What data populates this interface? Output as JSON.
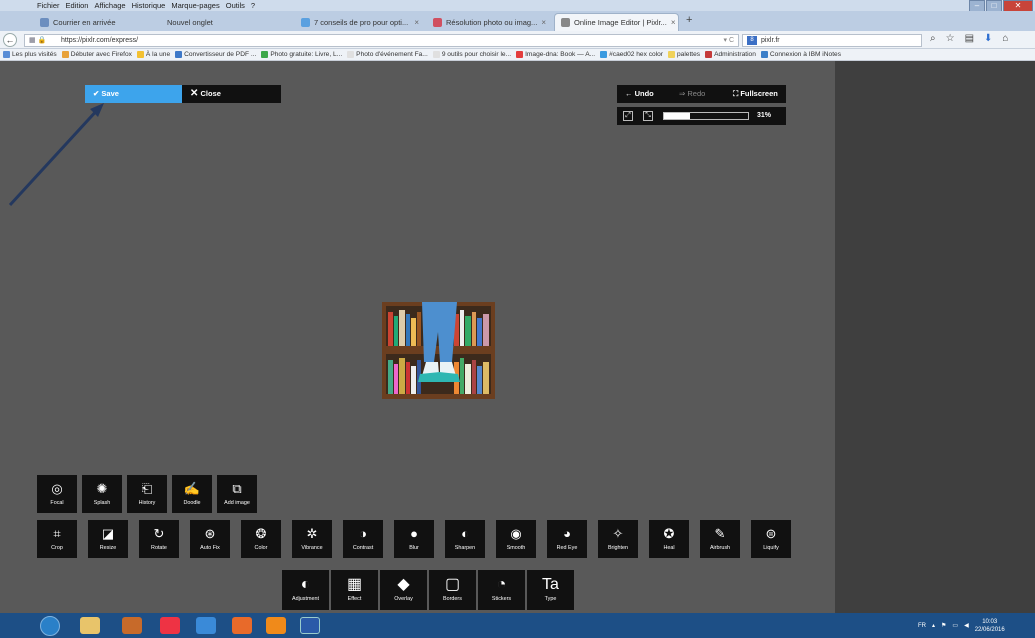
{
  "menubar": [
    "Fichier",
    "Edition",
    "Affichage",
    "Historique",
    "Marque-pages",
    "Outils",
    "?"
  ],
  "tabs": [
    {
      "label": "Courrier en arrivée",
      "color": "#6c8ebf"
    },
    {
      "label": "Nouvel onglet",
      "color": "#bccde3"
    },
    {
      "label": "7 conseils de pro pour opti...",
      "color": "#5aa0e0"
    },
    {
      "label": "Résolution photo ou imag...",
      "color": "#d05060"
    },
    {
      "label": "Online Image Editor | Pixlr...",
      "color": "#888888"
    }
  ],
  "url": "https://pixlr.com/express/",
  "search": "pixlr.fr",
  "bookmarks": [
    {
      "label": "Les plus visités",
      "color": "#5a8ed6"
    },
    {
      "label": "Débuter avec Firefox",
      "color": "#e8a23a"
    },
    {
      "label": "À la une",
      "color": "#f3c132"
    },
    {
      "label": "Convertisseur de PDF ...",
      "color": "#3d78c8"
    },
    {
      "label": "Photo gratuite: Livre, L...",
      "color": "#3da84a"
    },
    {
      "label": "Photo d'événement Fa...",
      "color": "#e0e0e0"
    },
    {
      "label": "9 outils pour choisir le...",
      "color": "#e0e0e0"
    },
    {
      "label": "Image-dna: Book — A...",
      "color": "#e33d3d"
    },
    {
      "label": "#caed02 hex color",
      "color": "#3a9ae0"
    },
    {
      "label": "palettes",
      "color": "#f0d25a"
    },
    {
      "label": "Administration",
      "color": "#c43a3a"
    },
    {
      "label": "Connexion à IBM iNotes",
      "color": "#3a7ec8"
    }
  ],
  "editor": {
    "save": "Save",
    "close": "Close",
    "undo": "Undo",
    "redo": "Redo",
    "fullscreen": "Fullscreen",
    "zoom": "31%",
    "zoom_value": 0.31
  },
  "tools_row1": [
    {
      "label": "Focal",
      "icon": "◎"
    },
    {
      "label": "Splash",
      "icon": "✺"
    },
    {
      "label": "History",
      "icon": "⎗"
    },
    {
      "label": "Doodle",
      "icon": "✍"
    },
    {
      "label": "Add image",
      "icon": "⧉"
    }
  ],
  "tools_row2": [
    {
      "label": "Crop",
      "icon": "⌗"
    },
    {
      "label": "Resize",
      "icon": "◪"
    },
    {
      "label": "Rotate",
      "icon": "↻"
    },
    {
      "label": "Auto Fix",
      "icon": "⊛"
    },
    {
      "label": "Color",
      "icon": "❂"
    },
    {
      "label": "Vibrance",
      "icon": "✲"
    },
    {
      "label": "Contrast",
      "icon": "◑"
    },
    {
      "label": "Blur",
      "icon": "●"
    },
    {
      "label": "Sharpen",
      "icon": "◐"
    },
    {
      "label": "Smooth",
      "icon": "◉"
    },
    {
      "label": "Red Eye",
      "icon": "◕"
    },
    {
      "label": "Brighten",
      "icon": "✧"
    },
    {
      "label": "Heal",
      "icon": "✪"
    },
    {
      "label": "Airbrush",
      "icon": "✎"
    },
    {
      "label": "Liquify",
      "icon": "⊜"
    }
  ],
  "tools_row3": [
    {
      "label": "Adjustment",
      "icon": "◐"
    },
    {
      "label": "Effect",
      "icon": "▦"
    },
    {
      "label": "Overlay",
      "icon": "◆"
    },
    {
      "label": "Borders",
      "icon": "▢"
    },
    {
      "label": "Stickers",
      "icon": "◔"
    },
    {
      "label": "Type",
      "icon": "Ta"
    }
  ],
  "tray": {
    "lang": "FR",
    "time": "10:03",
    "date": "22/06/2016"
  }
}
